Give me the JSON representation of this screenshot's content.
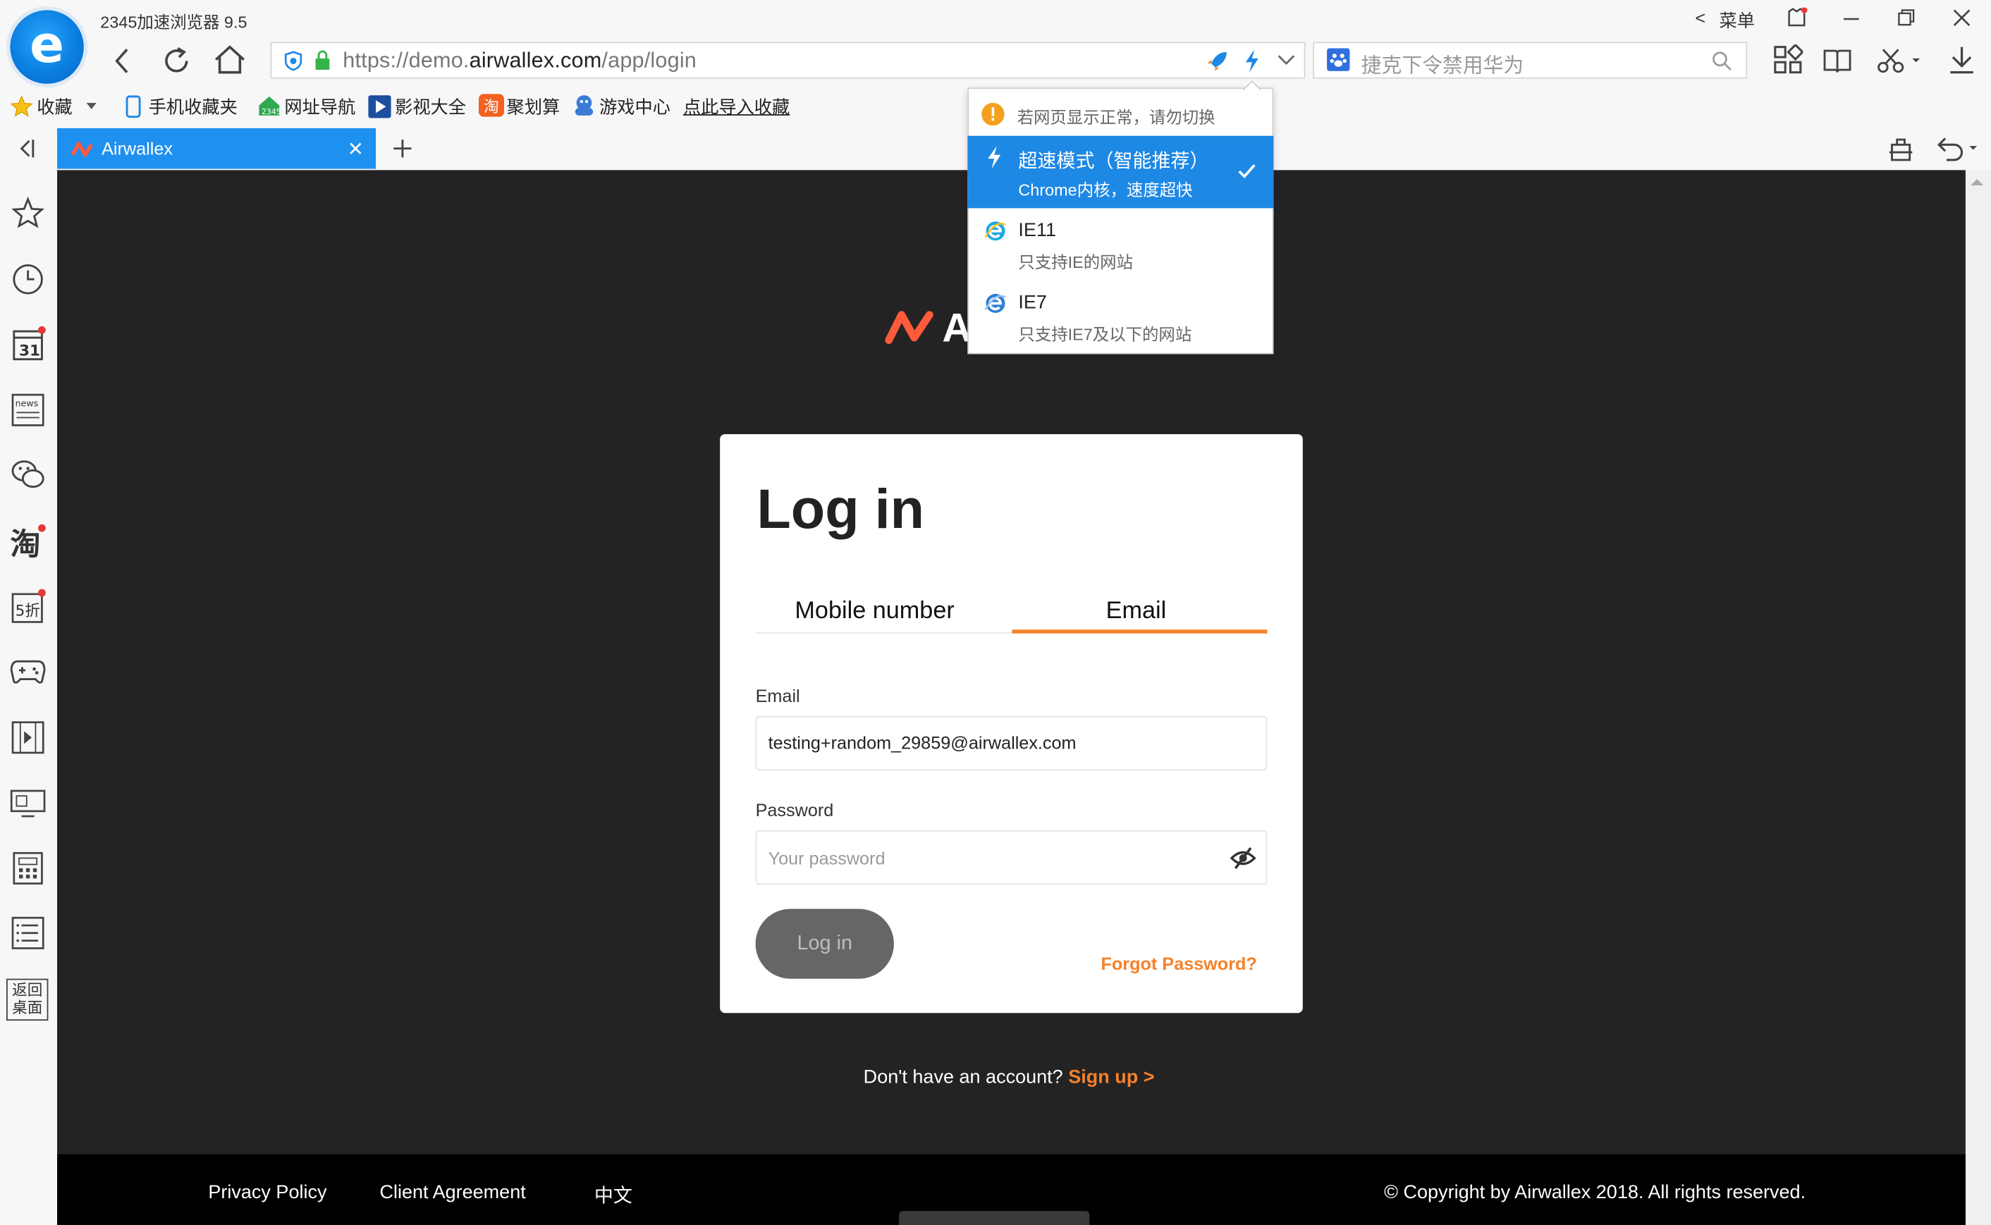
{
  "window": {
    "app_title": "2345加速浏览器 9.5",
    "menu_label": "菜单",
    "menu_back": "<"
  },
  "address_bar": {
    "url_prefix": "https://demo.",
    "url_domain": "airwallex.com",
    "url_path": "/app/login",
    "search_placeholder": "捷克下令禁用华为"
  },
  "bookmarks": [
    {
      "label": "收藏",
      "icon": "star-icon"
    },
    {
      "label": "手机收藏夹",
      "icon": "phone-icon"
    },
    {
      "label": "网址导航",
      "icon": "house-icon"
    },
    {
      "label": "影视大全",
      "icon": "film-icon"
    },
    {
      "label": "聚划算",
      "icon": "taobao-icon"
    },
    {
      "label": "游戏中心",
      "icon": "gamepad-icon"
    },
    {
      "label": "点此导入收藏",
      "icon": ""
    }
  ],
  "tabs": [
    {
      "label": "Airwallex",
      "active": true
    }
  ],
  "mode_dropdown": {
    "warning": "若网页显示正常，请勿切换",
    "options": [
      {
        "title": "超速模式（智能推荐）",
        "subtitle": "Chrome内核，速度超快",
        "selected": true
      },
      {
        "title": "IE11",
        "subtitle": "只支持IE的网站",
        "selected": false
      },
      {
        "title": "IE7",
        "subtitle": "只支持IE7及以下的网站",
        "selected": false
      }
    ]
  },
  "sidebar": {
    "calendar_day": "31",
    "news_label": "news",
    "discount_label": "5折",
    "back_desktop": "返回桌面"
  },
  "page": {
    "logo_letter": "A",
    "login": {
      "title": "Log in",
      "tab_mobile": "Mobile number",
      "tab_email": "Email",
      "active_tab": "Email",
      "email_label": "Email",
      "email_value": "testing+random_29859@airwallex.com",
      "password_label": "Password",
      "password_placeholder": "Your password",
      "submit_label": "Log in",
      "forgot_label": "Forgot Password?"
    },
    "signup_prompt": "Don't have an account?",
    "signup_link": "Sign up >",
    "footer": {
      "privacy": "Privacy Policy",
      "agreement": "Client Agreement",
      "language": "中文",
      "copyright": "© Copyright by Airwallex 2018. All rights reserved."
    }
  },
  "colors": {
    "accent": "#1e88e5",
    "brand_orange": "#f5822a",
    "page_bg": "#232323"
  }
}
